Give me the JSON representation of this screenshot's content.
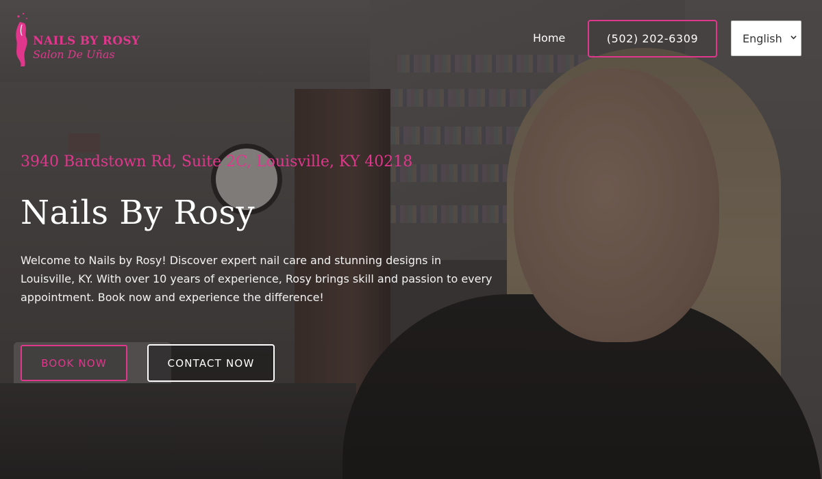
{
  "colors": {
    "accent": "#e0378c",
    "text_light": "#ffffff"
  },
  "header": {
    "logo": {
      "title": "NAILS BY ROSY",
      "subtitle": "Salon De Uñas",
      "icon": "hand-nail-polish-logo-icon"
    },
    "nav": {
      "home_label": "Home"
    },
    "phone_button_label": "(502) 202-6309",
    "language_select": {
      "selected": "English",
      "icon": "chevron-down-icon"
    }
  },
  "hero": {
    "address": "3940 Bardstown Rd, Suite 2C, Louisville, KY 40218",
    "title": "Nails By Rosy",
    "intro": "Welcome to Nails by Rosy! Discover expert nail care and stunning designs in Louisville, KY. With over 10 years of experience, Rosy brings skill and passion to every appointment. Book now and experience the difference!",
    "buttons": {
      "book": "BOOK NOW",
      "contact": "CONTACT NOW"
    }
  }
}
